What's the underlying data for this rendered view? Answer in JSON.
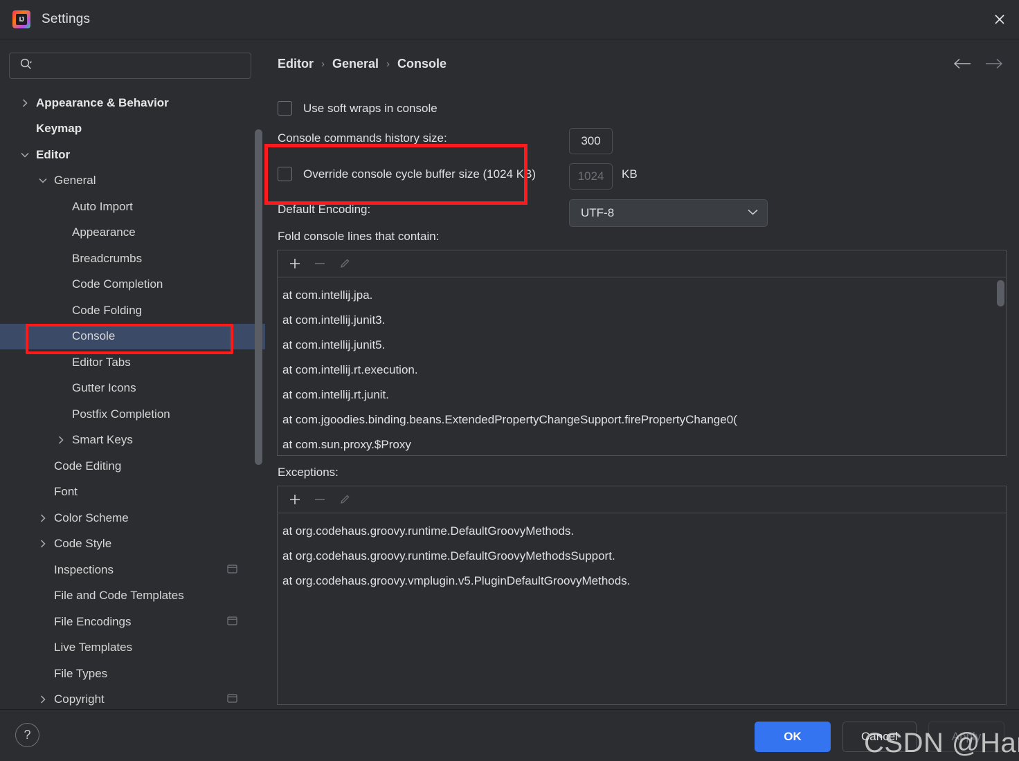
{
  "window": {
    "title": "Settings",
    "logo_text": "IJ",
    "close_label": "×"
  },
  "search": {
    "value": "",
    "placeholder": ""
  },
  "sidebar": {
    "items": [
      {
        "label": "Appearance & Behavior",
        "indent": 0,
        "chevron": "right",
        "bold": true,
        "selected": false,
        "scope_icon": false
      },
      {
        "label": "Keymap",
        "indent": 0,
        "chevron": "none",
        "bold": true,
        "selected": false,
        "scope_icon": false
      },
      {
        "label": "Editor",
        "indent": 0,
        "chevron": "down",
        "bold": true,
        "selected": false,
        "scope_icon": false
      },
      {
        "label": "General",
        "indent": 1,
        "chevron": "down",
        "bold": false,
        "selected": false,
        "scope_icon": false
      },
      {
        "label": "Auto Import",
        "indent": 2,
        "chevron": "none",
        "bold": false,
        "selected": false,
        "scope_icon": false
      },
      {
        "label": "Appearance",
        "indent": 2,
        "chevron": "none",
        "bold": false,
        "selected": false,
        "scope_icon": false
      },
      {
        "label": "Breadcrumbs",
        "indent": 2,
        "chevron": "none",
        "bold": false,
        "selected": false,
        "scope_icon": false
      },
      {
        "label": "Code Completion",
        "indent": 2,
        "chevron": "none",
        "bold": false,
        "selected": false,
        "scope_icon": false
      },
      {
        "label": "Code Folding",
        "indent": 2,
        "chevron": "none",
        "bold": false,
        "selected": false,
        "scope_icon": false
      },
      {
        "label": "Console",
        "indent": 2,
        "chevron": "none",
        "bold": false,
        "selected": true,
        "scope_icon": false
      },
      {
        "label": "Editor Tabs",
        "indent": 2,
        "chevron": "none",
        "bold": false,
        "selected": false,
        "scope_icon": false
      },
      {
        "label": "Gutter Icons",
        "indent": 2,
        "chevron": "none",
        "bold": false,
        "selected": false,
        "scope_icon": false
      },
      {
        "label": "Postfix Completion",
        "indent": 2,
        "chevron": "none",
        "bold": false,
        "selected": false,
        "scope_icon": false
      },
      {
        "label": "Smart Keys",
        "indent": 2,
        "chevron": "right",
        "bold": false,
        "selected": false,
        "scope_icon": false
      },
      {
        "label": "Code Editing",
        "indent": 1,
        "chevron": "none",
        "bold": false,
        "selected": false,
        "scope_icon": false
      },
      {
        "label": "Font",
        "indent": 1,
        "chevron": "none",
        "bold": false,
        "selected": false,
        "scope_icon": false
      },
      {
        "label": "Color Scheme",
        "indent": 1,
        "chevron": "right",
        "bold": false,
        "selected": false,
        "scope_icon": false
      },
      {
        "label": "Code Style",
        "indent": 1,
        "chevron": "right",
        "bold": false,
        "selected": false,
        "scope_icon": false
      },
      {
        "label": "Inspections",
        "indent": 1,
        "chevron": "none",
        "bold": false,
        "selected": false,
        "scope_icon": true
      },
      {
        "label": "File and Code Templates",
        "indent": 1,
        "chevron": "none",
        "bold": false,
        "selected": false,
        "scope_icon": false
      },
      {
        "label": "File Encodings",
        "indent": 1,
        "chevron": "none",
        "bold": false,
        "selected": false,
        "scope_icon": true
      },
      {
        "label": "Live Templates",
        "indent": 1,
        "chevron": "none",
        "bold": false,
        "selected": false,
        "scope_icon": false
      },
      {
        "label": "File Types",
        "indent": 1,
        "chevron": "none",
        "bold": false,
        "selected": false,
        "scope_icon": false
      },
      {
        "label": "Copyright",
        "indent": 1,
        "chevron": "right",
        "bold": false,
        "selected": false,
        "scope_icon": true
      }
    ]
  },
  "breadcrumb": {
    "part1": "Editor",
    "sep1": "›",
    "part2": "General",
    "sep2": "›",
    "part3": "Console"
  },
  "settings": {
    "soft_wraps_label": "Use soft wraps in console",
    "soft_wraps_checked": false,
    "history_size_label": "Console commands history size:",
    "history_size_value": "300",
    "override_buffer_label": "Override console cycle buffer size (1024 KB)",
    "override_buffer_checked": false,
    "buffer_value": "1024",
    "buffer_unit": "KB",
    "default_encoding_label": "Default Encoding:",
    "default_encoding_value": "UTF-8",
    "fold_lines_label": "Fold console lines that contain:",
    "exceptions_label": "Exceptions:"
  },
  "toolbar": {
    "add_label": "+",
    "remove_label": "−",
    "edit_label": "edit-pencil"
  },
  "fold_list": [
    "at com.intellij.jpa.",
    "at com.intellij.junit3.",
    "at com.intellij.junit5.",
    "at com.intellij.rt.execution.",
    "at com.intellij.rt.junit.",
    "at com.jgoodies.binding.beans.ExtendedPropertyChangeSupport.firePropertyChange0(",
    "at com.sun.proxy.$Proxy"
  ],
  "exceptions_list": [
    "at org.codehaus.groovy.runtime.DefaultGroovyMethods.",
    "at org.codehaus.groovy.runtime.DefaultGroovyMethodsSupport.",
    "at org.codehaus.groovy.vmplugin.v5.PluginDefaultGroovyMethods."
  ],
  "footer": {
    "help_label": "?",
    "ok_label": "OK",
    "cancel_label": "Cancel",
    "apply_label": "Apply"
  },
  "watermark": {
    "text": "CSDN @Hansdas"
  },
  "colors": {
    "accent": "#3574f0",
    "annotation_red": "#fb1a1d",
    "selection": "#3b4a67",
    "background": "#2b2d30"
  }
}
